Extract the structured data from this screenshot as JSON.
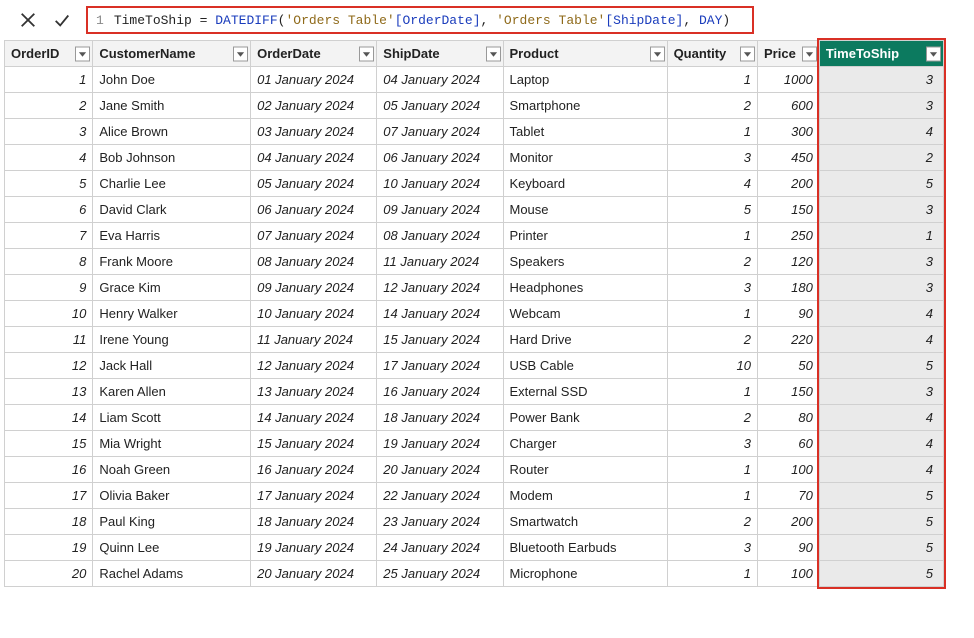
{
  "formula": {
    "line_number": "1",
    "measure_name": "TimeToShip",
    "eq": " = ",
    "func": "DATEDIFF",
    "open": "(",
    "tbl1": "'Orders Table'",
    "col1": "[OrderDate]",
    "comma1": ", ",
    "tbl2": "'Orders Table'",
    "col2": "[ShipDate]",
    "comma2": ", ",
    "kw": "DAY",
    "close": ")"
  },
  "columns": {
    "orderid": "OrderID",
    "customer": "CustomerName",
    "orderdate": "OrderDate",
    "shipdate": "ShipDate",
    "product": "Product",
    "quantity": "Quantity",
    "price": "Price",
    "timetoship": "TimeToShip"
  },
  "rows": [
    {
      "id": "1",
      "cust": "John Doe",
      "od": "01 January 2024",
      "sd": "04 January 2024",
      "prod": "Laptop",
      "qty": "1",
      "price": "1000",
      "tts": "3"
    },
    {
      "id": "2",
      "cust": "Jane Smith",
      "od": "02 January 2024",
      "sd": "05 January 2024",
      "prod": "Smartphone",
      "qty": "2",
      "price": "600",
      "tts": "3"
    },
    {
      "id": "3",
      "cust": "Alice Brown",
      "od": "03 January 2024",
      "sd": "07 January 2024",
      "prod": "Tablet",
      "qty": "1",
      "price": "300",
      "tts": "4"
    },
    {
      "id": "4",
      "cust": "Bob Johnson",
      "od": "04 January 2024",
      "sd": "06 January 2024",
      "prod": "Monitor",
      "qty": "3",
      "price": "450",
      "tts": "2"
    },
    {
      "id": "5",
      "cust": "Charlie Lee",
      "od": "05 January 2024",
      "sd": "10 January 2024",
      "prod": "Keyboard",
      "qty": "4",
      "price": "200",
      "tts": "5"
    },
    {
      "id": "6",
      "cust": "David Clark",
      "od": "06 January 2024",
      "sd": "09 January 2024",
      "prod": "Mouse",
      "qty": "5",
      "price": "150",
      "tts": "3"
    },
    {
      "id": "7",
      "cust": "Eva Harris",
      "od": "07 January 2024",
      "sd": "08 January 2024",
      "prod": "Printer",
      "qty": "1",
      "price": "250",
      "tts": "1"
    },
    {
      "id": "8",
      "cust": "Frank Moore",
      "od": "08 January 2024",
      "sd": "11 January 2024",
      "prod": "Speakers",
      "qty": "2",
      "price": "120",
      "tts": "3"
    },
    {
      "id": "9",
      "cust": "Grace Kim",
      "od": "09 January 2024",
      "sd": "12 January 2024",
      "prod": "Headphones",
      "qty": "3",
      "price": "180",
      "tts": "3"
    },
    {
      "id": "10",
      "cust": "Henry Walker",
      "od": "10 January 2024",
      "sd": "14 January 2024",
      "prod": "Webcam",
      "qty": "1",
      "price": "90",
      "tts": "4"
    },
    {
      "id": "11",
      "cust": "Irene Young",
      "od": "11 January 2024",
      "sd": "15 January 2024",
      "prod": "Hard Drive",
      "qty": "2",
      "price": "220",
      "tts": "4"
    },
    {
      "id": "12",
      "cust": "Jack Hall",
      "od": "12 January 2024",
      "sd": "17 January 2024",
      "prod": "USB Cable",
      "qty": "10",
      "price": "50",
      "tts": "5"
    },
    {
      "id": "13",
      "cust": "Karen Allen",
      "od": "13 January 2024",
      "sd": "16 January 2024",
      "prod": "External SSD",
      "qty": "1",
      "price": "150",
      "tts": "3"
    },
    {
      "id": "14",
      "cust": "Liam Scott",
      "od": "14 January 2024",
      "sd": "18 January 2024",
      "prod": "Power Bank",
      "qty": "2",
      "price": "80",
      "tts": "4"
    },
    {
      "id": "15",
      "cust": "Mia Wright",
      "od": "15 January 2024",
      "sd": "19 January 2024",
      "prod": "Charger",
      "qty": "3",
      "price": "60",
      "tts": "4"
    },
    {
      "id": "16",
      "cust": "Noah Green",
      "od": "16 January 2024",
      "sd": "20 January 2024",
      "prod": "Router",
      "qty": "1",
      "price": "100",
      "tts": "4"
    },
    {
      "id": "17",
      "cust": "Olivia Baker",
      "od": "17 January 2024",
      "sd": "22 January 2024",
      "prod": "Modem",
      "qty": "1",
      "price": "70",
      "tts": "5"
    },
    {
      "id": "18",
      "cust": "Paul King",
      "od": "18 January 2024",
      "sd": "23 January 2024",
      "prod": "Smartwatch",
      "qty": "2",
      "price": "200",
      "tts": "5"
    },
    {
      "id": "19",
      "cust": "Quinn Lee",
      "od": "19 January 2024",
      "sd": "24 January 2024",
      "prod": "Bluetooth Earbuds",
      "qty": "3",
      "price": "90",
      "tts": "5"
    },
    {
      "id": "20",
      "cust": "Rachel Adams",
      "od": "20 January 2024",
      "sd": "25 January 2024",
      "prod": "Microphone",
      "qty": "1",
      "price": "100",
      "tts": "5"
    }
  ],
  "highlights": {
    "formula_box_color": "#d93025",
    "tts_header_bg": "#0c7a5f"
  }
}
